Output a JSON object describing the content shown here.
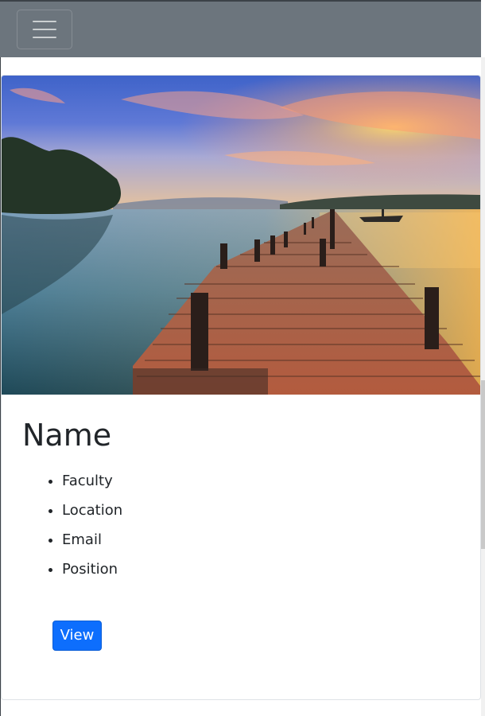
{
  "navbar": {
    "toggler_icon": "hamburger-menu-icon"
  },
  "card": {
    "image_description_icon": "sunset-lake-pier-image",
    "title": "Name",
    "items": [
      "Faculty",
      "Location",
      "Email",
      "Position"
    ],
    "button_label": "View"
  },
  "colors": {
    "navbar_bg": "#6c757d",
    "button_bg": "#0d6efd",
    "text": "#212529"
  }
}
